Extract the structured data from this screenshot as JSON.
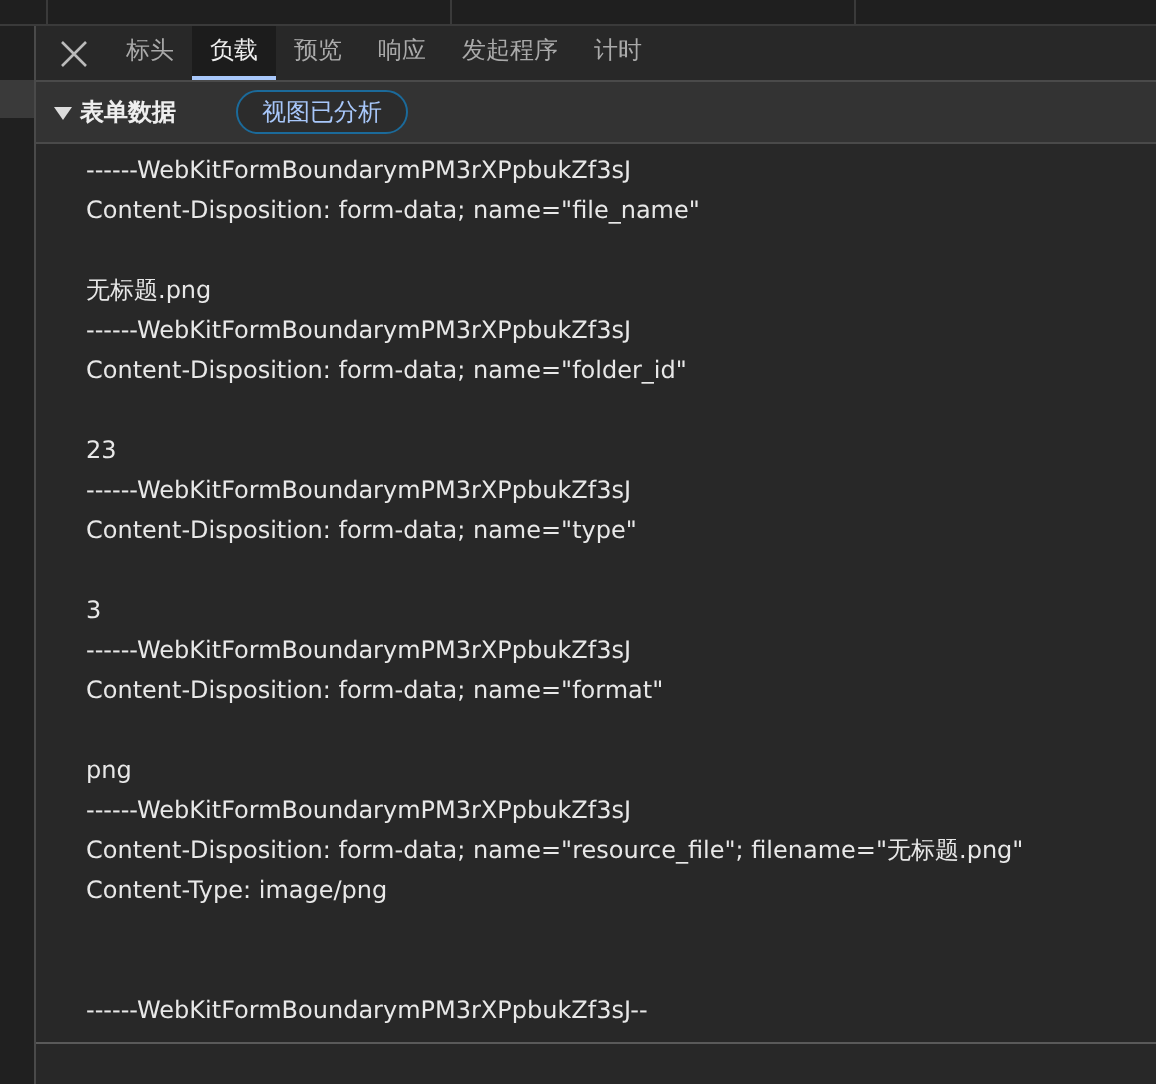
{
  "tabs": [
    {
      "label": "标头",
      "selected": false
    },
    {
      "label": "负载",
      "selected": true
    },
    {
      "label": "预览",
      "selected": false
    },
    {
      "label": "响应",
      "selected": false
    },
    {
      "label": "发起程序",
      "selected": false
    },
    {
      "label": "计时",
      "selected": false
    }
  ],
  "section": {
    "title": "表单数据",
    "expanded": true,
    "view_button": "视图已分析"
  },
  "lines": [
    {
      "kind": "text",
      "text": "------WebKitFormBoundarymPM3rXPpbukZf3sJ"
    },
    {
      "kind": "text",
      "text": "Content-Disposition: form-data; name=\"file_name\""
    },
    {
      "kind": "blank"
    },
    {
      "kind": "text",
      "text": "无标题.png"
    },
    {
      "kind": "text",
      "text": "------WebKitFormBoundarymPM3rXPpbukZf3sJ"
    },
    {
      "kind": "text",
      "text": "Content-Disposition: form-data; name=\"folder_id\""
    },
    {
      "kind": "blank"
    },
    {
      "kind": "text",
      "text": "23"
    },
    {
      "kind": "text",
      "text": "------WebKitFormBoundarymPM3rXPpbukZf3sJ"
    },
    {
      "kind": "text",
      "text": "Content-Disposition: form-data; name=\"type\""
    },
    {
      "kind": "blank"
    },
    {
      "kind": "text",
      "text": "3"
    },
    {
      "kind": "text",
      "text": "------WebKitFormBoundarymPM3rXPpbukZf3sJ"
    },
    {
      "kind": "text",
      "text": "Content-Disposition: form-data; name=\"format\""
    },
    {
      "kind": "blank"
    },
    {
      "kind": "text",
      "text": "png"
    },
    {
      "kind": "text",
      "text": "------WebKitFormBoundarymPM3rXPpbukZf3sJ"
    },
    {
      "kind": "text",
      "text": "Content-Disposition: form-data; name=\"resource_file\"; filename=\"无标题.png\""
    },
    {
      "kind": "text",
      "text": "Content-Type: image/png"
    },
    {
      "kind": "blank"
    },
    {
      "kind": "blank"
    },
    {
      "kind": "text",
      "text": "------WebKitFormBoundarymPM3rXPpbukZf3sJ--"
    }
  ]
}
